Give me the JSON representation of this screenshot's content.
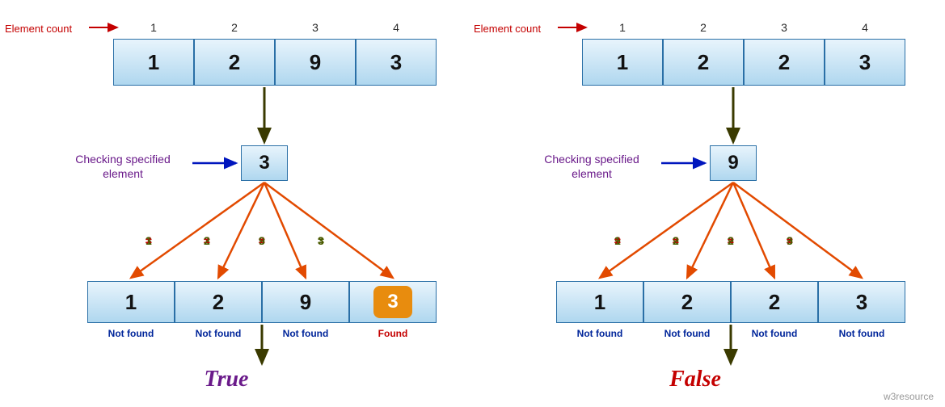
{
  "labels": {
    "element_count": "Element count",
    "checking": "Checking specified element",
    "not_found": "Not found",
    "found": "Found",
    "neq_symbol": "≠",
    "eq_symbol": "="
  },
  "watermark": "w3resource",
  "left": {
    "counts": [
      "1",
      "2",
      "3",
      "4"
    ],
    "top_cells": [
      "1",
      "2",
      "9",
      "3"
    ],
    "spec": "3",
    "comparisons": [
      {
        "a": "3",
        "op": "≠",
        "b": "1"
      },
      {
        "a": "3",
        "op": "≠",
        "b": "2"
      },
      {
        "a": "3",
        "op": "≠",
        "b": "9"
      },
      {
        "a": "3",
        "op": "=",
        "b": "3"
      }
    ],
    "bottom_cells": [
      "1",
      "2",
      "9",
      "3"
    ],
    "highlight_index": 3,
    "status": [
      "Not found",
      "Not found",
      "Not found",
      "Found"
    ],
    "result": "True"
  },
  "right": {
    "counts": [
      "1",
      "2",
      "3",
      "4"
    ],
    "top_cells": [
      "1",
      "2",
      "2",
      "3"
    ],
    "spec": "9",
    "comparisons": [
      {
        "a": "9",
        "op": "≠",
        "b": "1"
      },
      {
        "a": "9",
        "op": "≠",
        "b": "2"
      },
      {
        "a": "9",
        "op": "≠",
        "b": "2"
      },
      {
        "a": "9",
        "op": "≠",
        "b": "3"
      }
    ],
    "bottom_cells": [
      "1",
      "2",
      "2",
      "3"
    ],
    "highlight_index": null,
    "status": [
      "Not found",
      "Not found",
      "Not found",
      "Not found"
    ],
    "result": "False"
  }
}
